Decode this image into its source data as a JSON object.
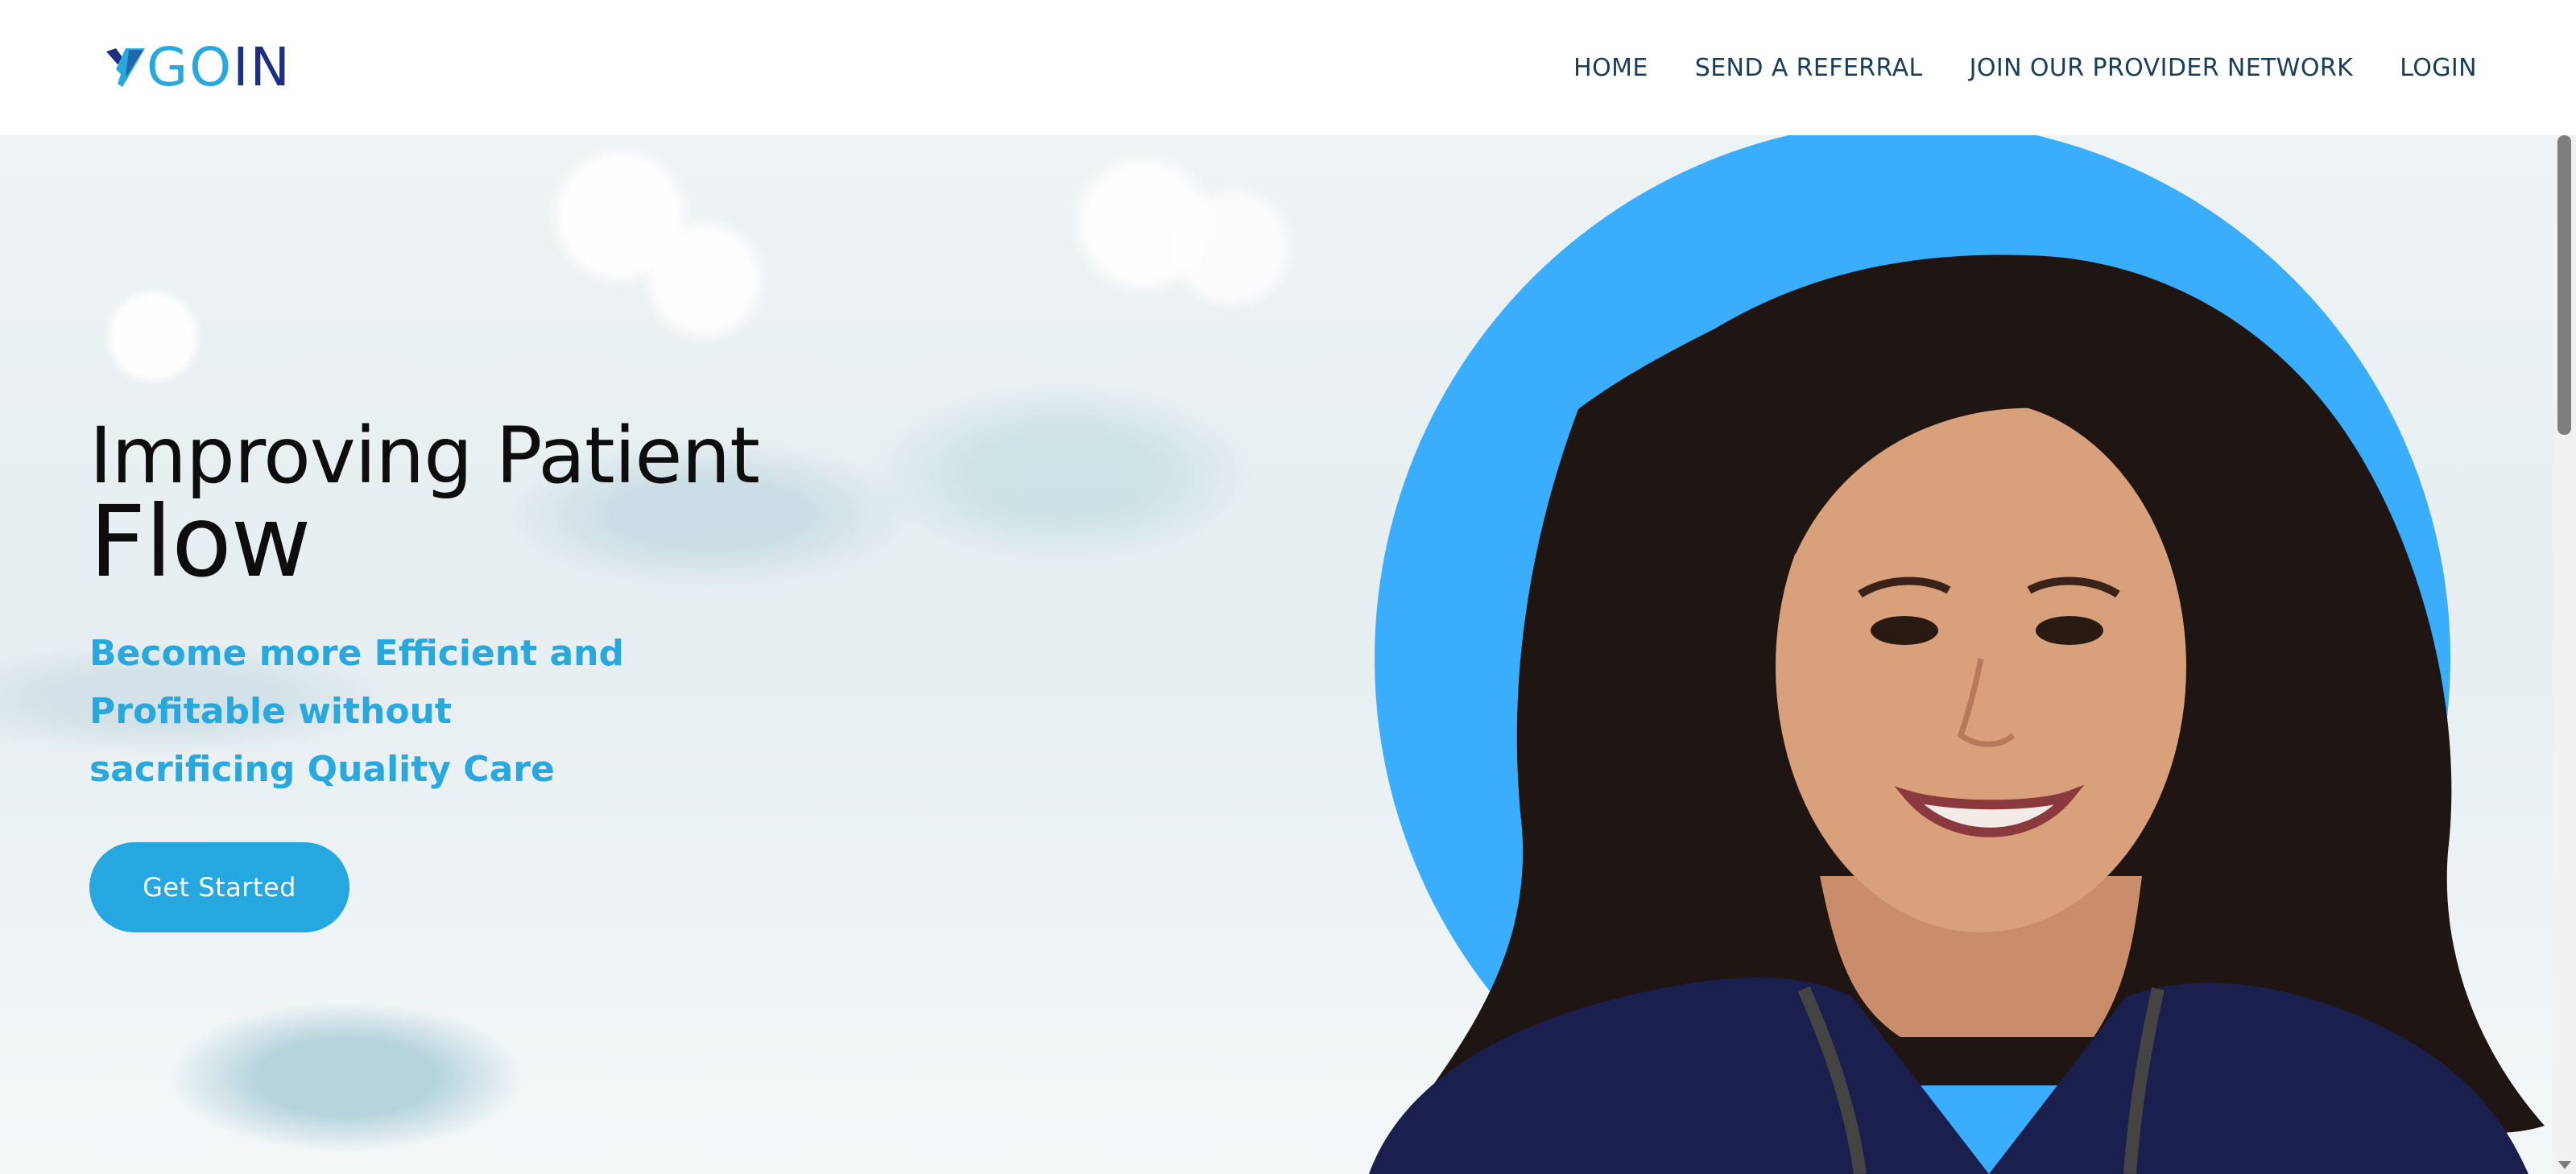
{
  "brand": {
    "logo_text_go": "GO",
    "logo_text_in": "IN",
    "logo_icon": "check-y-icon",
    "colors": {
      "primary": "#29a8de",
      "dark": "#1e2f83",
      "nav_text": "#1a3d5c"
    }
  },
  "nav": {
    "items": [
      {
        "label": "HOME"
      },
      {
        "label": "SEND A REFERRAL"
      },
      {
        "label": "JOIN OUR PROVIDER NETWORK"
      },
      {
        "label": "LOGIN"
      }
    ]
  },
  "hero": {
    "title_line1": "Improving Patient",
    "title_line2": "Flow",
    "subtitle": "Become more Efficient and Profitable without sacrificing Quality Care",
    "cta_label": "Get Started",
    "accent_circle_color": "#3aaefc"
  }
}
